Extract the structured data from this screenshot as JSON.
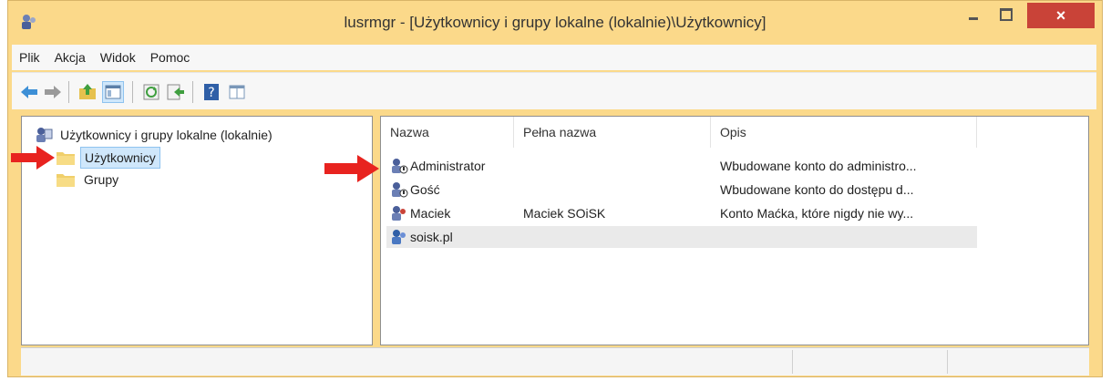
{
  "window": {
    "title": "lusrmgr - [Użytkownicy i grupy lokalne (lokalnie)\\Użytkownicy]",
    "close_symbol": "×"
  },
  "menu": [
    "Plik",
    "Akcja",
    "Widok",
    "Pomoc"
  ],
  "tree": {
    "root": "Użytkownicy i grupy lokalne (lokalnie)",
    "nodes": [
      {
        "label": "Użytkownicy",
        "selected": true
      },
      {
        "label": "Grupy",
        "selected": false
      }
    ]
  },
  "list": {
    "columns": [
      "Nazwa",
      "Pełna nazwa",
      "Opis"
    ],
    "rows": [
      {
        "name": "Administrator",
        "full_name": "",
        "description": "Wbudowane konto do administro..."
      },
      {
        "name": "Gość",
        "full_name": "",
        "description": "Wbudowane konto do dostępu d..."
      },
      {
        "name": "Maciek",
        "full_name": "Maciek SOiSK",
        "description": "Konto Maćka, które nigdy nie wy..."
      },
      {
        "name": "soisk.pl",
        "full_name": "",
        "description": ""
      }
    ]
  },
  "colors": {
    "frame": "#fbd98a",
    "close": "#c94338",
    "annotation_arrow": "#e8231f",
    "selection": "#cfe7fb"
  },
  "icons": [
    "app-icon",
    "back-icon",
    "forward-icon",
    "up-folder-icon",
    "show-tree-icon",
    "refresh-icon",
    "export-icon",
    "help-icon",
    "properties-icon",
    "folder-icon",
    "user-icon",
    "disabled-user-icon"
  ]
}
